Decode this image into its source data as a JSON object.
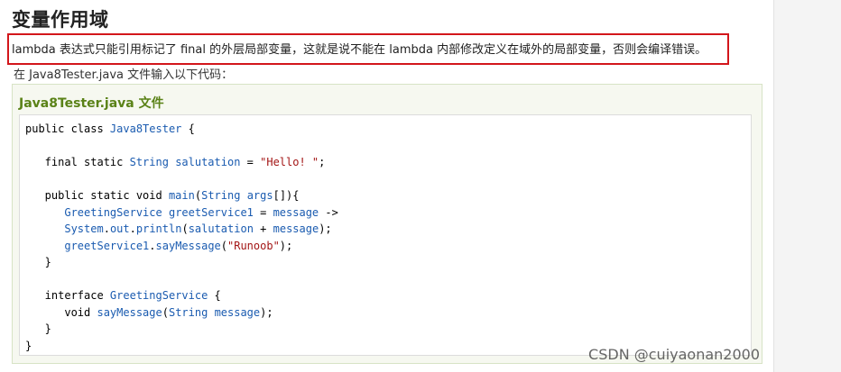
{
  "heading": "变量作用域",
  "highlighted_text": "lambda 表达式只能引用标记了 final 的外层局部变量，这就是说不能在 lambda 内部修改定义在域外的局部变量，否则会编译错误。",
  "intro_text": "在 Java8Tester.java 文件输入以下代码：",
  "example": {
    "title": "Java8Tester.java 文件",
    "code_lines": [
      "public class Java8Tester {",
      "",
      "   final static String salutation = \"Hello! \";",
      "",
      "   public static void main(String args[]){",
      "      GreetingService greetService1 = message ->",
      "      System.out.println(salutation + message);",
      "      greetService1.sayMessage(\"Runoob\");",
      "   }",
      "",
      "   interface GreetingService {",
      "      void sayMessage(String message);",
      "   }",
      "}"
    ]
  },
  "watermark": "CSDN @cuiyaonan2000",
  "colors": {
    "highlight_border": "#d3161b",
    "example_title": "#5a8217",
    "code_type": "#1a5bb0",
    "code_string": "#a31515"
  }
}
